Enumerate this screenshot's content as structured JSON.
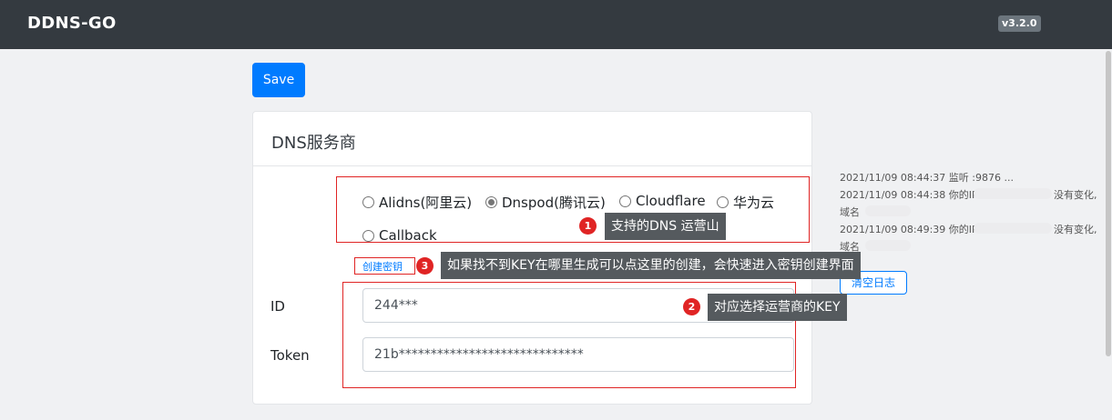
{
  "navbar": {
    "brand": "DDNS-GO",
    "version": "v3.2.0"
  },
  "toolbar": {
    "save_label": "Save"
  },
  "dns_card": {
    "title": "DNS服务商",
    "providers": [
      {
        "label": "Alidns(阿里云)",
        "selected": false
      },
      {
        "label": "Dnspod(腾讯云)",
        "selected": true
      },
      {
        "label": "Cloudflare",
        "selected": false
      },
      {
        "label": "华为云",
        "selected": false
      },
      {
        "label": "Callback",
        "selected": false
      }
    ],
    "create_key_link": "创建密钥",
    "id_label": "ID",
    "id_value": "244***",
    "token_label": "Token",
    "token_value": "21b*****************************"
  },
  "logs": {
    "lines": [
      "2021/11/09 08:44:37 监听 :9876 ...",
      "2021/11/09 08:44:38 你的IP",
      "没有变化,",
      "域名",
      "2021/11/09 08:49:39 你的IP",
      "没有变化,",
      "域名"
    ],
    "clear_label": "清空日志"
  },
  "annotations": [
    {
      "number": "1",
      "text": "支持的DNS 运营山"
    },
    {
      "number": "2",
      "text": "对应选择运营商的KEY"
    },
    {
      "number": "3",
      "text": "如果找不到KEY在哪里生成可以点这里的创建，会快速进入密钥创建界面"
    }
  ]
}
